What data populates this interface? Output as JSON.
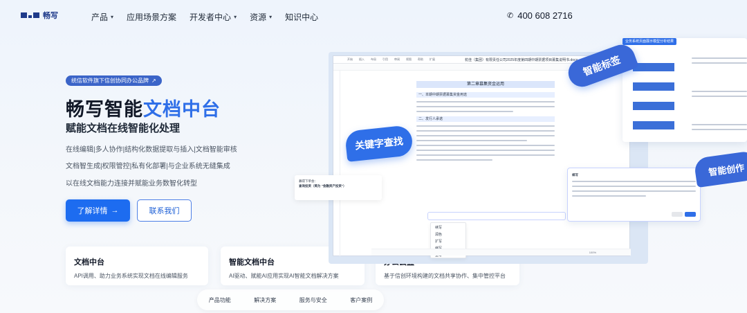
{
  "nav": {
    "logo_text": "畅写",
    "menu": [
      {
        "label": "产品",
        "dropdown": true
      },
      {
        "label": "应用场景方案",
        "dropdown": false
      },
      {
        "label": "开发者中心",
        "dropdown": true
      },
      {
        "label": "资源",
        "dropdown": true
      },
      {
        "label": "知识中心",
        "dropdown": false
      }
    ],
    "phone": "400 608 2716"
  },
  "hero": {
    "badge": "统信软件旗下信创协同办公品牌",
    "title_prefix": "畅写智能",
    "title_highlight": "文档中台",
    "subtitle": "赋能文档在线智能化处理",
    "desc_lines": [
      "在线编辑|多人协作|结构化数据提取与插入|文档智能审核",
      "文档智生成|权限管控|私有化部署|与企业系统无缝集成",
      "以在线文档能力连接并赋能业务数智化转型"
    ],
    "primary_button": "了解详情",
    "secondary_button": "联系我们"
  },
  "cards": [
    {
      "title": "文档中台",
      "desc": "API调用、助力业务系统实现文档在线编辑服务"
    },
    {
      "title": "智能文档中台",
      "desc": "AI驱动、赋能AI应用实现AI智能文档解决方案"
    },
    {
      "title": "办公云盘",
      "desc": "基于信创环境构建的文档共享协作、集中管控平台"
    }
  ],
  "tabs": [
    "产品功能",
    "解决方案",
    "服务与安全",
    "客户案例"
  ],
  "illustration": {
    "bubble_keyword": "关键字查找",
    "bubble_tag": "智能标签",
    "bubble_create": "智能创作",
    "tagbox_header": "业务系统页面展示模型分析结果",
    "doc_filename": "杭佳（集团）有限责任公司2025年度第四期中期票据项目募集说明书.docx",
    "doc_heading": "第二章募集资金运用",
    "doc_sections": [
      "一、本期中期票据募集资金用途",
      "二、发行人承诺"
    ],
    "toolbar_tabs": [
      "开始",
      "插入",
      "布局",
      "引用",
      "审阅",
      "视图",
      "帮助",
      "扩展"
    ],
    "ai_menu": [
      "续写",
      "润色",
      "扩写",
      "缩写",
      "重写"
    ],
    "search_card": {
      "title": "募得下单会：",
      "query": "查询投资（简为 \"金融资产投资\"）"
    },
    "write_card_title": "续写",
    "status_zoom": "100%"
  }
}
